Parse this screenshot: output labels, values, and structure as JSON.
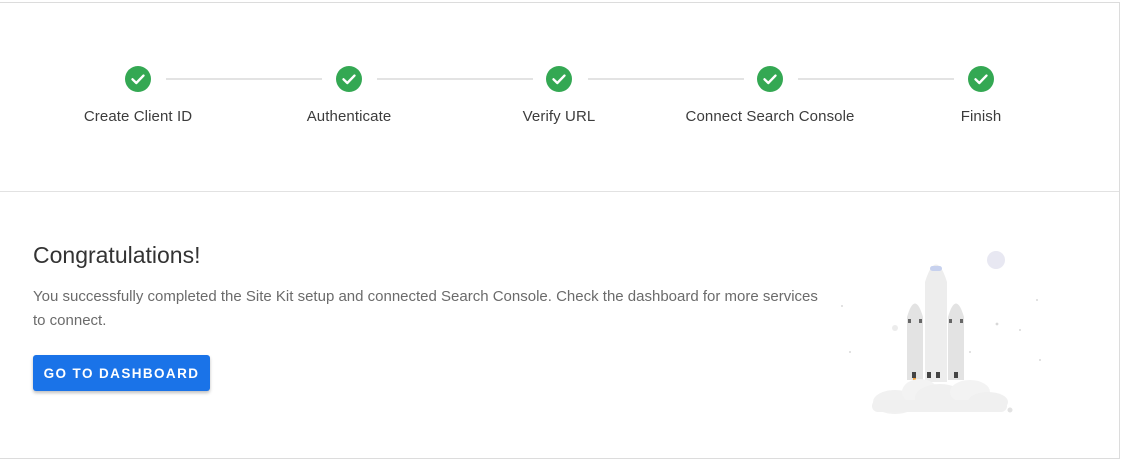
{
  "steps": [
    {
      "label": "Create Client ID",
      "status": "complete"
    },
    {
      "label": "Authenticate",
      "status": "complete"
    },
    {
      "label": "Verify URL",
      "status": "complete"
    },
    {
      "label": "Connect Search Console",
      "status": "complete"
    },
    {
      "label": "Finish",
      "status": "complete"
    }
  ],
  "completion": {
    "title": "Congratulations!",
    "description": "You successfully completed the Site Kit setup and connected Search Console. Check the dashboard for more services to connect.",
    "button_label": "GO TO DASHBOARD"
  },
  "illustration": {
    "icon": "rocket-launch-illustration"
  },
  "colors": {
    "check": "#34a853",
    "primary_button": "#1a73e8",
    "connector": "#e3e3e3"
  }
}
